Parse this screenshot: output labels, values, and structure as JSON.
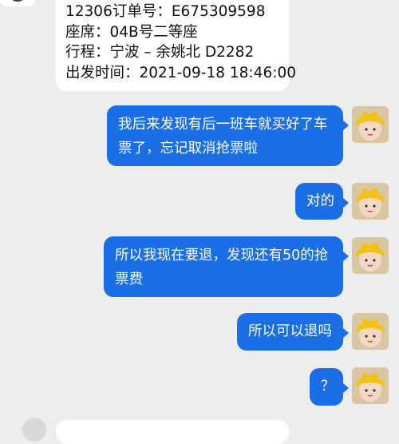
{
  "order_card": {
    "order_no": "12306订单号：E675309598",
    "seat": "座席：04B号二等座",
    "route": "行程：宁波 – 余姚北 D2282",
    "departure": "出发时间：2021-09-18 18:46:00"
  },
  "messages": [
    {
      "lines": [
        "我后来发现有后一班车就买好了车",
        "票了，忘记取消抢票啦"
      ]
    },
    {
      "lines": [
        "对的"
      ]
    },
    {
      "lines": [
        "所以我现在要退，发现还有50的抢",
        "票费"
      ]
    },
    {
      "lines": [
        "所以可以退吗"
      ]
    },
    {
      "lines": [
        "？"
      ]
    }
  ],
  "colors": {
    "background": "#ededed",
    "outgoing_bubble": "#1a6ee6",
    "incoming_bubble": "#ffffff"
  },
  "icons": {
    "user_avatar": "yellow-hat-avatar",
    "agent_avatar": "profile-avatar"
  }
}
